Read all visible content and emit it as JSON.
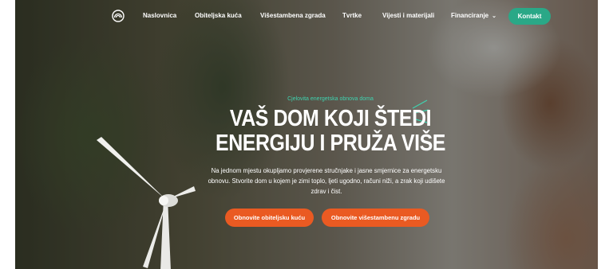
{
  "nav": {
    "logo_icon": "semicircle-arches-logo",
    "links": [
      {
        "label": "Naslovnica"
      },
      {
        "label": "Obiteljska kuća"
      },
      {
        "label": "Višestambena zgrada"
      },
      {
        "label": "Tvrtke"
      },
      {
        "label": "Vijesti i materijali"
      },
      {
        "label": "Financiranje",
        "icon": "chevron-down-icon"
      }
    ],
    "cta_label": "Kontakt"
  },
  "hero": {
    "kicker": "Cjelovita energetska obnova doma",
    "headline_line1": "VAŠ DOM KOJI ŠTEDI",
    "headline_line2": "ENERGIJU I PRUŽA VIŠE",
    "subtext": "Na jednom mjestu okupljamo provjerene stručnjake i jasne smjernice za energetsku obnovu. Stvorite dom u kojem je zimi toplo, ljeti ugodno, računi niži, a zrak koji udišete zdrav i čist.",
    "primary_button": "Obnovite obiteljsku kuću",
    "secondary_button": "Obnovite višestambenu zgradu"
  },
  "colors": {
    "accent_green": "#2aa887",
    "accent_orange": "#ea5a22",
    "kicker_teal": "#3fd3b0"
  }
}
